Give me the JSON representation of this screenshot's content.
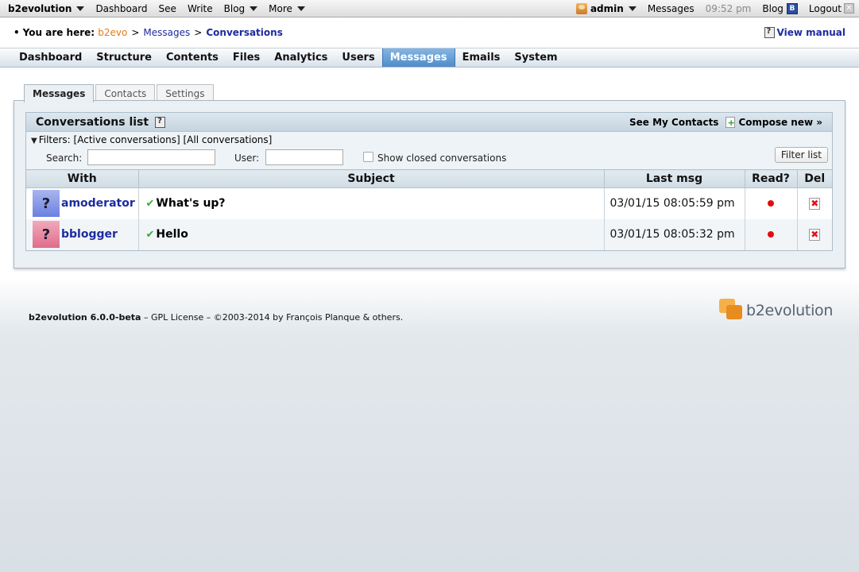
{
  "evobar": {
    "brand": "b2evolution",
    "left_items": [
      "Dashboard",
      "See",
      "Write",
      "Blog",
      "More"
    ],
    "user": "admin",
    "messages": "Messages",
    "time": "09:52 pm",
    "blog": "Blog",
    "blog_icon_letter": "B",
    "logout": "Logout"
  },
  "breadcrumb": {
    "bullet": "•",
    "prefix": "You are here:",
    "items": [
      "b2evo",
      "Messages",
      "Conversations"
    ],
    "separator": ">",
    "view_manual": "View manual"
  },
  "mainmenu": {
    "items": [
      "Dashboard",
      "Structure",
      "Contents",
      "Files",
      "Analytics",
      "Users",
      "Messages",
      "Emails",
      "System"
    ],
    "active": "Messages"
  },
  "subtabs": [
    "Messages",
    "Contacts",
    "Settings"
  ],
  "conversations": {
    "title": "Conversations list",
    "see_contacts": "See My Contacts",
    "compose": "Compose new »",
    "filters": {
      "label": "Filters:",
      "active_link": "[Active conversations]",
      "all_link": "[All conversations]",
      "search_label": "Search:",
      "search_value": "",
      "user_label": "User:",
      "user_value": "",
      "show_closed": "Show closed conversations",
      "button": "Filter list"
    },
    "columns": [
      "With",
      "Subject",
      "Last msg",
      "Read?",
      "Del"
    ],
    "rows": [
      {
        "avatar": "?",
        "with": "amoderator",
        "subject": "What's up?",
        "last_msg": "03/01/15 08:05:59 pm",
        "avatar_color": "#7c8fe6"
      },
      {
        "avatar": "?",
        "with": "bblogger",
        "subject": "Hello",
        "last_msg": "03/01/15 08:05:32 pm",
        "avatar_color": "#e77f9a"
      }
    ]
  },
  "footer": {
    "product": "b2evolution 6.0.0-beta",
    "rest": "– GPL License – ©2003-2014 by François Planque & others.",
    "logo_text": "b2evolution"
  },
  "colors": {
    "link_blue": "#1d2ba0",
    "accent_orange": "#e47b16",
    "active_tab": "#4f8cc9",
    "unread_dot": "#e30d0d"
  }
}
